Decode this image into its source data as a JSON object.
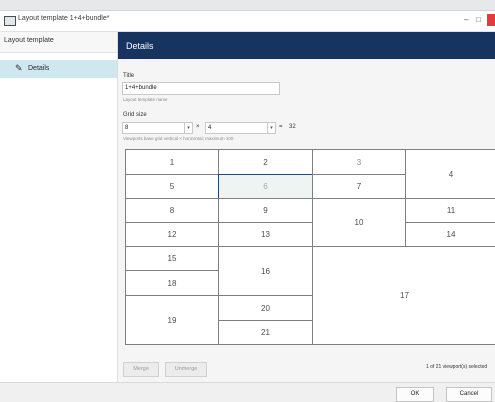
{
  "window": {
    "title": "Layout template 1+4+bundle*",
    "minimize": "–",
    "maximize": "□"
  },
  "sidebar": {
    "header": "Layout template",
    "items": [
      {
        "label": "Details",
        "icon": "pencil-icon"
      }
    ]
  },
  "details": {
    "header": "Details",
    "title_label": "Title",
    "title_value": "1+4+bundle",
    "title_hint": "Layout template name",
    "grid_size_label": "Grid size",
    "rows": "8",
    "times": "×",
    "cols": "4",
    "equals": "=",
    "total": "32",
    "grid_hint": "Viewports base grid vertical × horizontal; maximum 100"
  },
  "cells": [
    "1",
    "2",
    "3",
    "4",
    "5",
    "6",
    "7",
    "8",
    "9",
    "10",
    "11",
    "12",
    "13",
    "14",
    "15",
    "16",
    "17",
    "18",
    "19",
    "20",
    "21"
  ],
  "buttons": {
    "merge": "Merge",
    "unmerge": "Unmerge",
    "ok": "OK",
    "cancel": "Cancel"
  },
  "status": "1 of 21 viewport(s) selected",
  "colors": {
    "header_bg": "#173460",
    "sidebar_selected": "#cfe8ef",
    "close_button": "#e23b3b"
  }
}
